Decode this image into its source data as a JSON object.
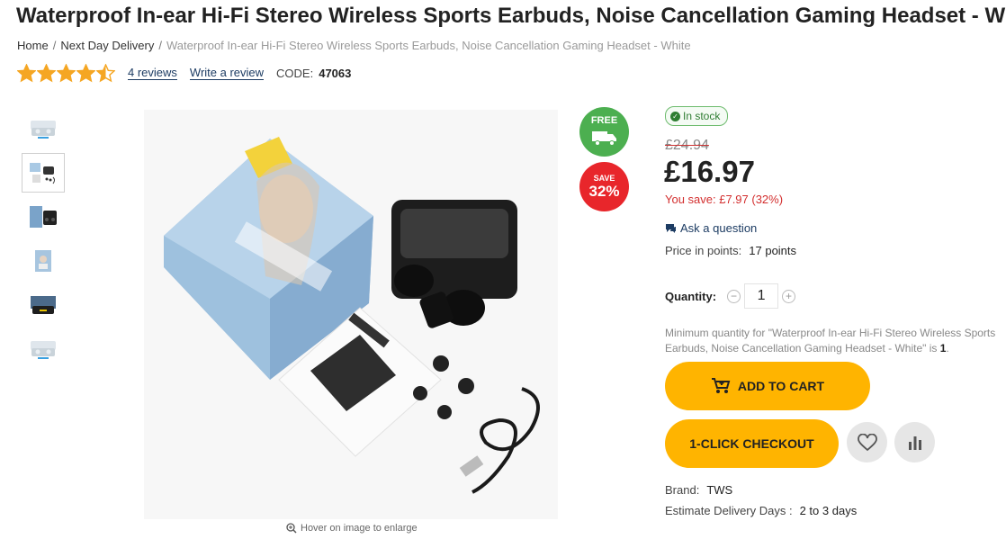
{
  "product": {
    "title": "Waterproof In-ear Hi-Fi Stereo Wireless Sports Earbuds, Noise Cancellation Gaming Headset - White",
    "code_label": "CODE:",
    "code": "47063"
  },
  "breadcrumb": {
    "home": "Home",
    "category": "Next Day Delivery",
    "current": "Waterproof In-ear Hi-Fi Stereo Wireless Sports Earbuds, Noise Cancellation Gaming Headset - White",
    "separator": "/"
  },
  "rating": {
    "value": 4.5,
    "max": 5,
    "reviews_link": "4 reviews",
    "write_review": "Write a review",
    "star_color": "#f5a623"
  },
  "gallery": {
    "thumbnail_count": 6,
    "active_index": 1,
    "hover_hint": "Hover on image to enlarge"
  },
  "badges": {
    "free_label": "FREE",
    "free_icon": "delivery-truck-icon",
    "save_label": "SAVE",
    "save_percent": "32%",
    "free_color": "#4caf50",
    "save_color": "#e8262b"
  },
  "pricing": {
    "stock_status": "In stock",
    "old_price": "£24.94",
    "price": "£16.97",
    "you_save": "You save: £7.97 (32%)"
  },
  "actions": {
    "ask_question": "Ask a question",
    "points_label": "Price in points:",
    "points_value": "17 points",
    "quantity_label": "Quantity:",
    "quantity_value": "1",
    "min_quantity_text": "Minimum quantity for \"Waterproof In-ear Hi-Fi Stereo Wireless Sports Earbuds, Noise Cancellation Gaming Headset - White\" is ",
    "min_quantity_value": "1",
    "min_quantity_suffix": ".",
    "add_to_cart": "ADD TO CART",
    "one_click_checkout": "1-CLICK CHECKOUT",
    "accent_color": "#ffb400"
  },
  "details": {
    "brand_label": "Brand:",
    "brand_value": "TWS",
    "delivery_label": "Estimate Delivery Days :",
    "delivery_value": "2 to 3 days"
  }
}
